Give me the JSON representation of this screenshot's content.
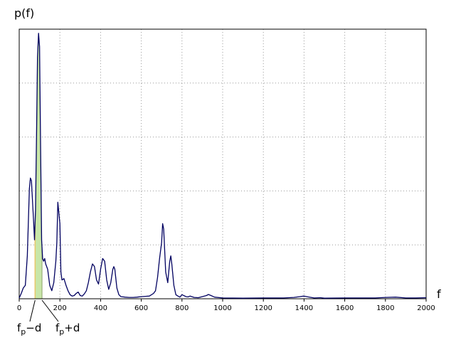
{
  "chart_data": {
    "type": "line",
    "ylabel": "p(f)",
    "xlabel": "f",
    "xlim": [
      0,
      2000
    ],
    "x_ticks": [
      "0",
      "200",
      "400",
      "600",
      "800",
      "1000",
      "1200",
      "1400",
      "1600",
      "1800",
      "2000"
    ],
    "grid": true,
    "line_color": "#000060",
    "band_color": "#c8e6a8",
    "band_edge_color": "#e8c76a",
    "annotations": [
      {
        "base": "f",
        "sub": "p",
        "suffix": "−d",
        "x": 78
      },
      {
        "base": "f",
        "sub": "p",
        "suffix": "+d",
        "x": 112
      }
    ],
    "band": {
      "x_start": 78,
      "x_end": 112
    },
    "series": [
      {
        "x": [
          0,
          10,
          20,
          30,
          40,
          50,
          55,
          60,
          70,
          75,
          80,
          85,
          90,
          95,
          100,
          105,
          110,
          115,
          120,
          125,
          130,
          140,
          150,
          160,
          170,
          180,
          185,
          190,
          200,
          205,
          210,
          220,
          230,
          240,
          250,
          260,
          270,
          280,
          290,
          300,
          310,
          320,
          330,
          340,
          350,
          360,
          370,
          380,
          390,
          400,
          410,
          420,
          430,
          440,
          450,
          460,
          465,
          470,
          480,
          490,
          500,
          520,
          540,
          560,
          580,
          600,
          620,
          640,
          660,
          670,
          680,
          690,
          700,
          705,
          710,
          720,
          730,
          740,
          745,
          750,
          760,
          770,
          780,
          790,
          800,
          820,
          830,
          840,
          860,
          880,
          900,
          920,
          930,
          940,
          960,
          1000,
          1100,
          1200,
          1300,
          1350,
          1380,
          1400,
          1420,
          1450,
          1480,
          1500,
          1600,
          1700,
          1750,
          1800,
          1850,
          1900,
          1950,
          2000
        ],
        "y": [
          0.3,
          2.0,
          4.0,
          5.0,
          16.0,
          41.0,
          45.0,
          44.0,
          30.0,
          22.0,
          33.0,
          60.0,
          90.0,
          99.0,
          94.0,
          58.0,
          22.0,
          15.0,
          14.0,
          15.0,
          13.0,
          11.0,
          5.0,
          3.0,
          6.0,
          14.0,
          21.0,
          36.0,
          28.0,
          10.0,
          7.0,
          7.5,
          5.0,
          3.0,
          1.5,
          1.0,
          1.2,
          2.0,
          2.5,
          1.2,
          1.0,
          1.8,
          3.0,
          6.0,
          10.0,
          13.0,
          12.0,
          7.0,
          5.5,
          11.0,
          15.0,
          14.0,
          7.0,
          3.5,
          6.0,
          11.0,
          12.0,
          11.0,
          4.0,
          1.5,
          0.8,
          0.6,
          0.5,
          0.5,
          0.6,
          0.8,
          0.9,
          1.0,
          2.0,
          3.0,
          8.0,
          15.0,
          21.0,
          28.0,
          26.0,
          10.0,
          6.0,
          14.0,
          16.0,
          13.0,
          5.0,
          1.5,
          1.0,
          0.6,
          1.5,
          0.8,
          0.7,
          1.0,
          0.5,
          0.4,
          0.8,
          1.2,
          1.6,
          1.3,
          0.6,
          0.3,
          0.2,
          0.3,
          0.3,
          0.5,
          0.8,
          1.0,
          0.7,
          0.3,
          0.4,
          0.2,
          0.3,
          0.3,
          0.3,
          0.5,
          0.6,
          0.3,
          0.3,
          0.4
        ]
      }
    ]
  }
}
